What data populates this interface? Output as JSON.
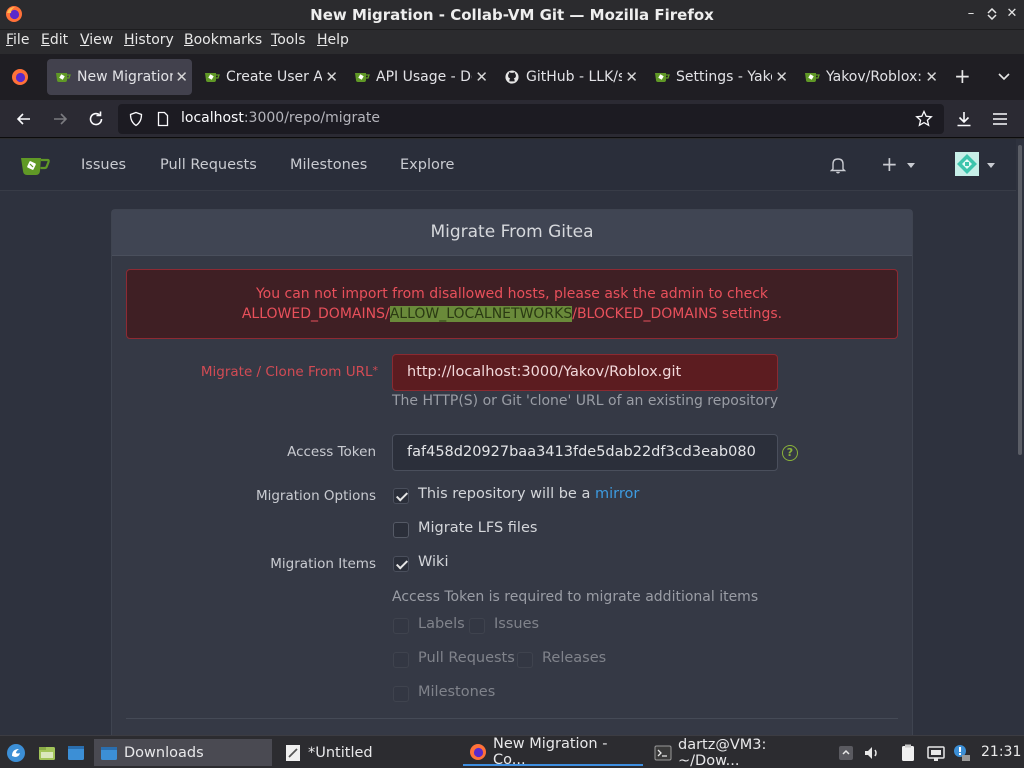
{
  "window": {
    "title": "New Migration - Collab-VM Git — Mozilla Firefox"
  },
  "menu": {
    "items": [
      {
        "first": "F",
        "rest": "ile"
      },
      {
        "first": "E",
        "rest": "dit"
      },
      {
        "first": "V",
        "rest": "iew"
      },
      {
        "first": "H",
        "rest": "istory"
      },
      {
        "first": "B",
        "rest": "ookmarks"
      },
      {
        "first": "T",
        "rest": "ools"
      },
      {
        "first": "H",
        "rest": "elp"
      }
    ]
  },
  "tabs": [
    {
      "label": "New Migration",
      "active": true
    },
    {
      "label": "Create User Ac",
      "active": false
    },
    {
      "label": "API Usage - Do",
      "active": false
    },
    {
      "label": "GitHub - LLK/s",
      "active": false
    },
    {
      "label": "Settings - Yako",
      "active": false
    },
    {
      "label": "Yakov/Roblox:",
      "active": false
    }
  ],
  "urlbar": {
    "host": "localhost",
    "path": ":3000/repo/migrate"
  },
  "gitea_nav": {
    "links": [
      "Issues",
      "Pull Requests",
      "Milestones",
      "Explore"
    ]
  },
  "form": {
    "title": "Migrate From Gitea",
    "error": {
      "line1": "You can not import from disallowed hosts, please ask the admin to check",
      "line2_before": "ALLOWED_DOMAINS/",
      "line2_highlight": "ALLOW_LOCALNETWORKS",
      "line2_after": "/BLOCKED_DOMAINS settings."
    },
    "clone_url": {
      "label": "Migrate / Clone From URL",
      "required_mark": "*",
      "value": "http://localhost:3000/Yakov/Roblox.git",
      "help": "The HTTP(S) or Git 'clone' URL of an existing repository"
    },
    "access_token": {
      "label": "Access Token",
      "value": "faf458d20927baa3413fde5dab22df3cd3eab080",
      "help_icon": "?"
    },
    "migration_options": {
      "label": "Migration Options",
      "mirror_text": "This repository will be a ",
      "mirror_link": "mirror",
      "mirror_checked": true,
      "lfs_label": "Migrate LFS files",
      "lfs_checked": false
    },
    "migration_items": {
      "label": "Migration Items",
      "wiki_label": "Wiki",
      "wiki_checked": true,
      "token_note": "Access Token is required to migrate additional items",
      "disabled_items": [
        "Labels",
        "Issues",
        "Pull Requests",
        "Releases",
        "Milestones"
      ]
    }
  },
  "taskbar": {
    "items": [
      {
        "label": "Downloads"
      },
      {
        "label": "*Untitled"
      },
      {
        "label": "New Migration - Co..."
      },
      {
        "label": "dartz@VM3: ~/Dow..."
      }
    ],
    "clock": "21:31"
  }
}
